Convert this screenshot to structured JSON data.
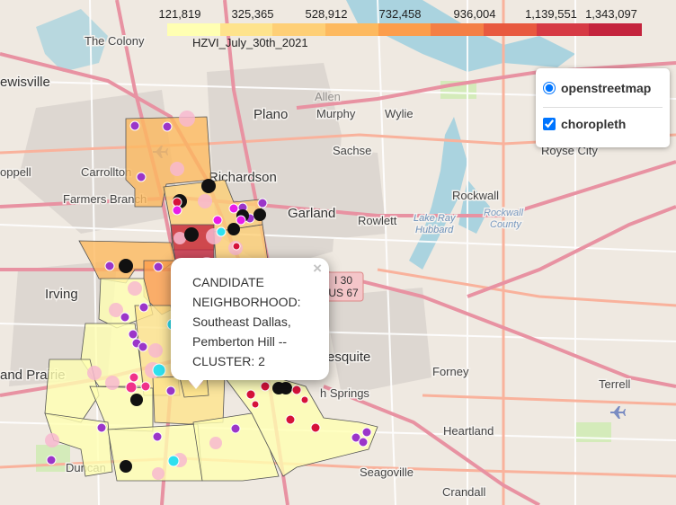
{
  "legend": {
    "ticks": [
      "121,819",
      "325,365",
      "528,912",
      "732,458",
      "936,004",
      "1,139,551",
      "1,343,097"
    ],
    "colors": [
      "#ffffb2",
      "#fee38c",
      "#fecf76",
      "#fdb95f",
      "#fc9d4b",
      "#f47f45",
      "#e8593f",
      "#d63a44",
      "#c4243d"
    ],
    "caption": "HZVI_July_30th_2021"
  },
  "layers": {
    "base": {
      "label": "openstreetmap",
      "checked": true
    },
    "overlay": {
      "label": "choropleth",
      "checked": true
    }
  },
  "popup": {
    "text": "CANDIDATE NEIGHBORHOOD: Southeast Dallas, Pemberton Hill -- CLUSTER: 2",
    "close_symbol": "×"
  },
  "map_labels": {
    "the_colony": "The Colony",
    "lewisville": "ewisville",
    "plano": "Plano",
    "murphy": "Murphy",
    "wylie": "Wylie",
    "allen": "Allen",
    "carrollton": "Carrollton",
    "coppell": "oppell",
    "farmers_branch": "Farmers Branch",
    "richardson": "Richardson",
    "sachse": "Sachse",
    "royse_city": "Royse City",
    "garland": "Garland",
    "rowlett": "Rowlett",
    "rockwall": "Rockwall",
    "lake_ray_hubbard_1": "Lake Ray",
    "lake_ray_hubbard_2": "Hubbard",
    "rockwall_county_1": "Rockwall",
    "rockwall_county_2": "County",
    "irving": "Irving",
    "grand_prairie": "and Prairie",
    "mesquite": "esquite",
    "forney": "Forney",
    "terrell": "Terrell",
    "heartland": "Heartland",
    "balch_springs": "h Springs",
    "duncanville": "Duncan",
    "seagoville": "Seagoville",
    "crandall": "Crandall",
    "i30": "I 30",
    "us67": "US 67"
  },
  "map_style": {
    "water": "#aad3df",
    "highway": "#e892a2",
    "road": "#f9b29c",
    "markers": {
      "purple": "#9b36c9",
      "black": "#111111",
      "red": "#d6133a",
      "magenta": "#e81ce8",
      "cyan": "#2ee0ee",
      "pink": "#f7b9cf",
      "hotpink": "#f0328a"
    }
  }
}
